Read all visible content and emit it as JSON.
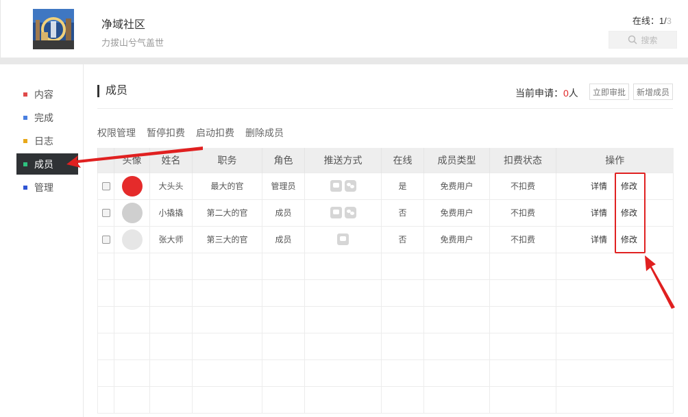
{
  "header": {
    "app_title": "净域社区",
    "subtitle": "力拔山兮气盖世",
    "online_label": "在线：1/",
    "online_tail": "3",
    "search_label": "搜索"
  },
  "sidebar": {
    "items": [
      {
        "label": "内容",
        "color": "#e04a4a"
      },
      {
        "label": "完成",
        "color": "#4a7fe0"
      },
      {
        "label": "日志",
        "color": "#e8a81a"
      },
      {
        "label": "成员",
        "color": "#2ec27e",
        "active": true
      },
      {
        "label": "管理",
        "color": "#2f55d4"
      }
    ]
  },
  "main": {
    "title": "成员",
    "apply_prefix": "当前申请：",
    "apply_count": "0",
    "apply_suffix": "人",
    "approve_button": "立即审批",
    "add_member_button": "新增成员",
    "actions": [
      "权限管理",
      "暂停扣费",
      "启动扣费",
      "删除成员"
    ]
  },
  "table": {
    "headers": [
      "",
      "头像",
      "姓名",
      "职务",
      "角色",
      "推送方式",
      "在线",
      "成员类型",
      "扣费状态",
      "操作"
    ],
    "rows": [
      {
        "name": "大头头",
        "position": "最大的官",
        "role": "管理员",
        "push": [
          "message",
          "wechat"
        ],
        "online": "是",
        "member_type": "免费用户",
        "billing": "不扣费",
        "detail": "详情",
        "edit": "修改"
      },
      {
        "name": "小撬撬",
        "position": "第二大的官",
        "role": "成员",
        "push": [
          "message",
          "wechat"
        ],
        "online": "否",
        "member_type": "免费用户",
        "billing": "不扣费",
        "detail": "详情",
        "edit": "修改"
      },
      {
        "name": "张大师",
        "position": "第三大的官",
        "role": "成员",
        "push": [
          "message"
        ],
        "online": "否",
        "member_type": "免费用户",
        "billing": "不扣费",
        "detail": "详情",
        "edit": "修改"
      }
    ]
  },
  "colors": {
    "accent_red": "#e02020",
    "sidebar_active_bg": "#2f3235"
  }
}
